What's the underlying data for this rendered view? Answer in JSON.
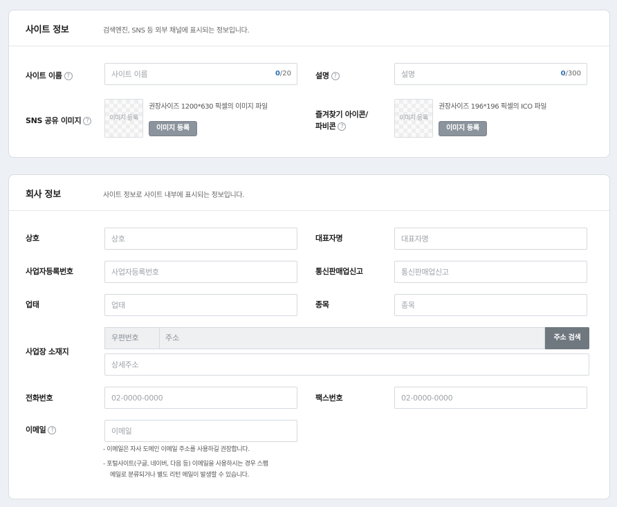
{
  "site_info": {
    "title": "사이트 정보",
    "description": "검색엔진, SNS 등 외부 채널에 표시되는 정보입니다.",
    "site_name": {
      "label": "사이트 이름",
      "help": "?",
      "placeholder": "사이트 이름",
      "count": "0",
      "max": "/20"
    },
    "desc": {
      "label": "설명",
      "help": "?",
      "placeholder": "설명",
      "count": "0",
      "max": "/300"
    },
    "sns_image": {
      "label": "SNS 공유 이미지",
      "help": "?",
      "box_text": "이미지 등록",
      "note": "권장사이즈 1200*630 픽셀의 이미지 파일",
      "button": "이미지 등록"
    },
    "favicon": {
      "label_line1": "즐겨찾기 아이콘/",
      "label_line2": "파비콘",
      "help": "?",
      "box_text": "이미지 등록",
      "note": "권장사이즈 196*196 픽셀의 ICO 파일",
      "button": "이미지 등록"
    }
  },
  "company_info": {
    "title": "회사 정보",
    "description": "사이트 정보로 사이트 내부에 표시되는 정보입니다.",
    "company_name": {
      "label": "상호",
      "placeholder": "상호"
    },
    "ceo": {
      "label": "대표자명",
      "placeholder": "대표자명"
    },
    "biz_reg": {
      "label": "사업자등록번호",
      "placeholder": "사업자등록번호"
    },
    "ecommerce": {
      "label": "통신판매업신고",
      "placeholder": "통신판매업신고"
    },
    "biz_type": {
      "label": "업태",
      "placeholder": "업태"
    },
    "biz_item": {
      "label": "종목",
      "placeholder": "종목"
    },
    "address": {
      "label": "사업장 소재지",
      "zip": "우편번호",
      "main": "주소",
      "search_button": "주소 검색",
      "detail_placeholder": "상세주소"
    },
    "phone": {
      "label": "전화번호",
      "placeholder": "02-0000-0000"
    },
    "fax": {
      "label": "팩스번호",
      "placeholder": "02-0000-0000"
    },
    "email": {
      "label": "이메일",
      "help": "?",
      "placeholder": "이메일",
      "note1": "-  이메일은 자사 도메인 이메일 주소를 사용하길 권장합니다.",
      "note2_line1": "-  포털사이트(구글, 네이버, 다음 등) 이메일을 사용하시는 경우 스팸",
      "note2_line2": "메일로 분류되거나 별도 리턴 메일이 발생할 수 있습니다."
    }
  }
}
